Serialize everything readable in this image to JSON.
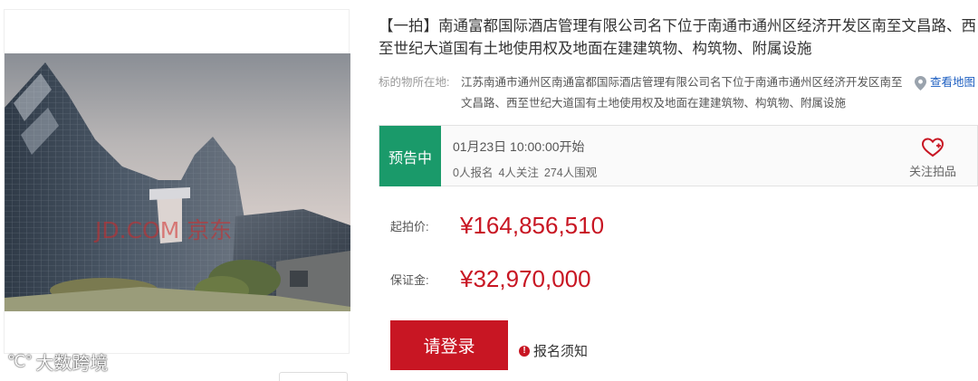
{
  "image": {
    "alt": "南通富都国际酒店建筑外观照片",
    "watermark": "JD.COM 京东",
    "site_watermark": "大数跨境",
    "site_logo_icon": "chat-logo-icon"
  },
  "item": {
    "title": "【一拍】南通富都国际酒店管理有限公司名下位于南通市通州区经济开发区南至文昌路、西至世纪大道国有土地使用权及地面在建建筑物、构筑物、附属设施"
  },
  "location": {
    "label": "标的物所在地:",
    "text": "江苏南通市通州区南通富都国际酒店管理有限公司名下位于南通市通州区经济开发区南至文昌路、西至世纪大道国有土地使用权及地面在建建筑物、构筑物、附属设施",
    "map_link": "查看地图",
    "map_icon": "location-pin-icon"
  },
  "status": {
    "badge": "预告中",
    "start_time": "01月23日 10:00:00开始",
    "registered": "0人报名",
    "followers": "4人关注",
    "watchers": "274人围观",
    "follow_label": "关注拍品",
    "follow_icon": "heart-plus-icon",
    "colors": {
      "badge": "#1a9a6a",
      "accent": "#c81623",
      "link": "#1e5fc1"
    }
  },
  "prices": {
    "starting_label": "起拍价:",
    "starting_value": "¥164,856,510",
    "deposit_label": "保证金:",
    "deposit_value": "¥32,970,000"
  },
  "actions": {
    "login_button": "请登录",
    "notice_label": "报名须知",
    "notice_icon": "alert-icon"
  }
}
